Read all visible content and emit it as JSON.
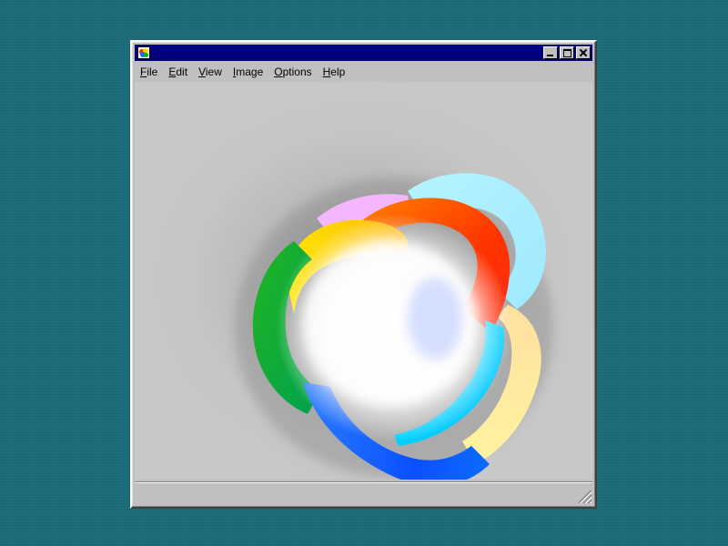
{
  "window": {
    "title": "",
    "controls": {
      "minimize_icon": "minimize-icon",
      "maximize_icon": "maximize-icon",
      "close_icon": "close-icon"
    }
  },
  "menu": {
    "items": [
      {
        "accel": "F",
        "rest": "ile"
      },
      {
        "accel": "E",
        "rest": "dit"
      },
      {
        "accel": "V",
        "rest": "iew"
      },
      {
        "accel": "I",
        "rest": "mage"
      },
      {
        "accel": "O",
        "rest": "ptions"
      },
      {
        "accel": "H",
        "rest": "elp"
      }
    ]
  },
  "colors": {
    "desktop": "#1e6f7d",
    "titlebar": "#000080",
    "window": "#c0c0c0"
  },
  "image": {
    "description_icon": "rainbow-ribbon-image"
  },
  "status": {
    "text": ""
  }
}
